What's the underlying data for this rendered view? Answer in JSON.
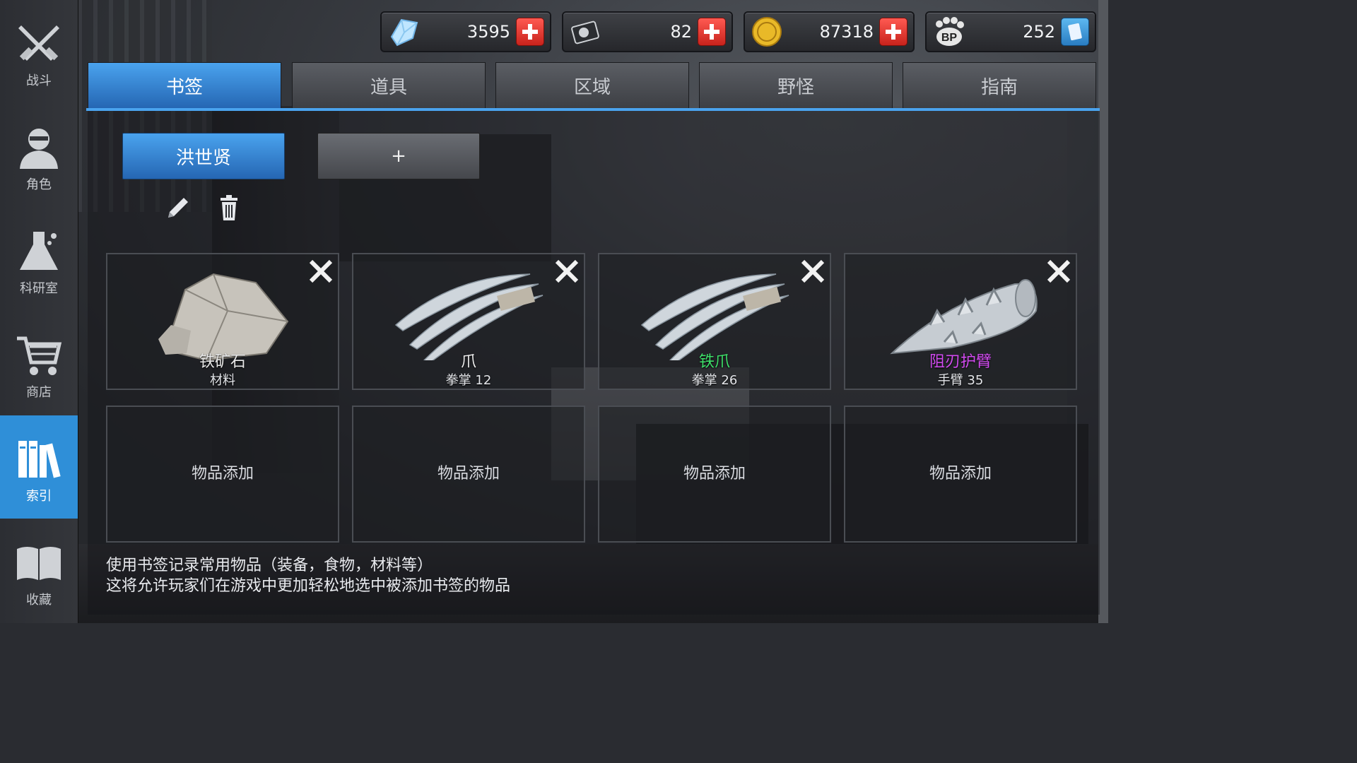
{
  "sidebar": {
    "items": [
      {
        "label": "战斗",
        "icon": "crossed-weapons-icon"
      },
      {
        "label": "角色",
        "icon": "character-bust-icon"
      },
      {
        "label": "科研室",
        "icon": "flask-icon"
      },
      {
        "label": "商店",
        "icon": "shopping-cart-icon"
      },
      {
        "label": "索引",
        "icon": "books-icon",
        "active": true
      },
      {
        "label": "收藏",
        "icon": "open-book-icon"
      }
    ]
  },
  "currency": [
    {
      "value": "3595",
      "icon": "crystal-icon"
    },
    {
      "value": "82",
      "icon": "hard-drive-icon"
    },
    {
      "value": "87318",
      "icon": "gold-coin-icon"
    },
    {
      "value": "252",
      "icon": "bp-paw-icon"
    }
  ],
  "tabs": [
    "书签",
    "道具",
    "区域",
    "野怪",
    "指南"
  ],
  "bookmark": {
    "active_label": "洪世贤",
    "add_label": "+"
  },
  "items": [
    {
      "name": "铁矿石",
      "sub": "材料",
      "name_color": "#e8e8e8",
      "icon": "iron-ore-icon"
    },
    {
      "name": "爪",
      "sub": "拳掌 12",
      "name_color": "#f0f0f0",
      "icon": "claw-icon"
    },
    {
      "name": "铁爪",
      "sub": "拳掌 26",
      "name_color": "#3ee06a",
      "icon": "iron-claw-icon"
    },
    {
      "name": "阻刃护臂",
      "sub": "手臂 35",
      "name_color": "#d24bf0",
      "icon": "arm-guard-icon"
    }
  ],
  "empty_slot_label": "物品添加",
  "footer": {
    "line1": "使用书签记录常用物品（装备，食物，材料等）",
    "line2": "这将允许玩家们在游戏中更加轻松地选中被添加书签的物品"
  },
  "colors": {
    "accent": "#2f8fd8",
    "plus_red": "#e0352d"
  }
}
